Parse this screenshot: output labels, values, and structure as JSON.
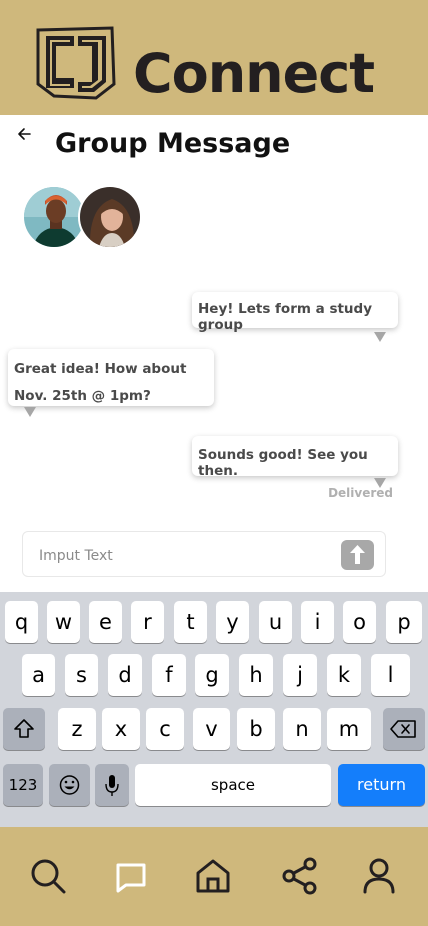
{
  "app": {
    "brand": "Connect",
    "logo_icon": "cu-logo-icon"
  },
  "colors": {
    "gold": "#cfb87c",
    "dark": "#231f20",
    "return_key": "#147efb"
  },
  "page": {
    "title": "Group Message",
    "back_icon": "back-arrow-icon"
  },
  "participants": [
    {
      "icon": "avatar-man"
    },
    {
      "icon": "avatar-woman"
    }
  ],
  "messages": [
    {
      "side": "right",
      "lines": [
        "Hey! Lets form a study group"
      ]
    },
    {
      "side": "left",
      "lines": [
        "Great idea! How about",
        "Nov. 25th @ 1pm?"
      ]
    },
    {
      "side": "right",
      "lines": [
        "Sounds good! See you then."
      ]
    }
  ],
  "status": "Delivered",
  "composer": {
    "placeholder": "Imput Text",
    "value": "",
    "send_icon": "send-arrow-icon"
  },
  "keyboard": {
    "row1": [
      "q",
      "w",
      "e",
      "r",
      "t",
      "y",
      "u",
      "i",
      "o",
      "p"
    ],
    "row2": [
      "a",
      "s",
      "d",
      "f",
      "g",
      "h",
      "j",
      "k",
      "l"
    ],
    "row3": [
      "z",
      "x",
      "c",
      "v",
      "b",
      "n",
      "m"
    ],
    "numbers": "123",
    "space": "space",
    "return": "return"
  },
  "nav": [
    {
      "icon": "search-icon"
    },
    {
      "icon": "chat-icon"
    },
    {
      "icon": "home-icon"
    },
    {
      "icon": "share-icon"
    },
    {
      "icon": "profile-icon"
    }
  ]
}
